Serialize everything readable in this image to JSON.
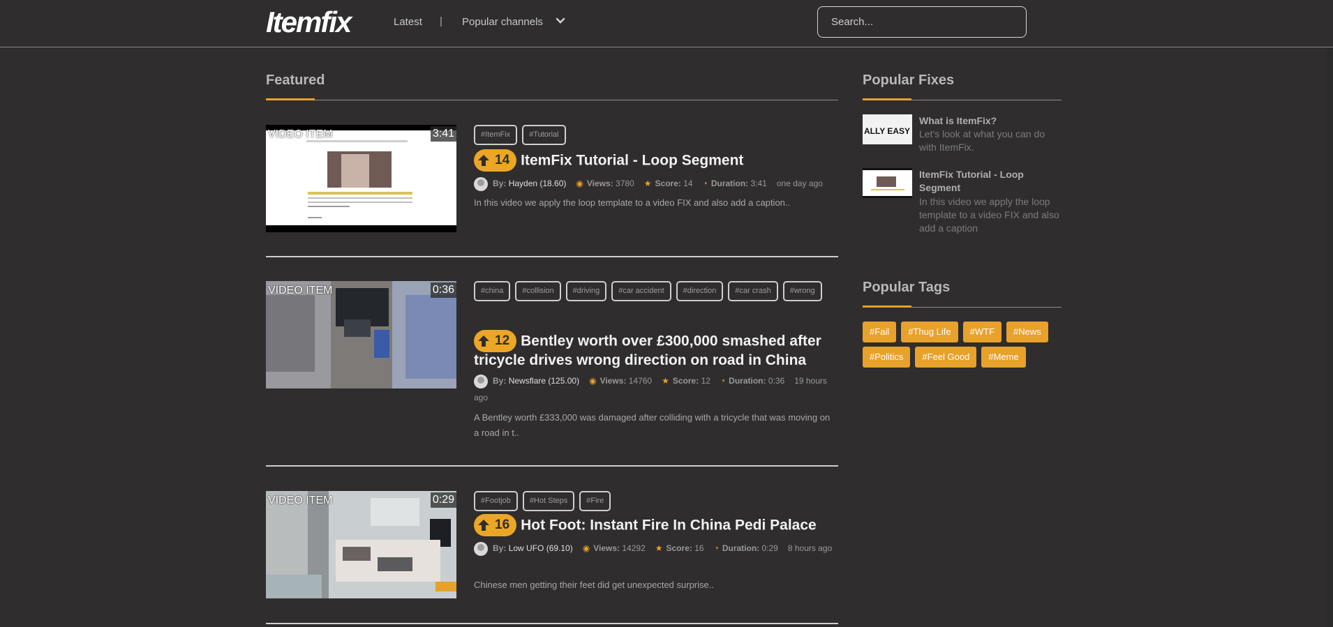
{
  "header": {
    "logo": "Itemfix",
    "nav_latest": "Latest",
    "nav_separator": "|",
    "nav_popular": "Popular channels",
    "search_placeholder": "Search..."
  },
  "featured": {
    "title": "Featured",
    "items": [
      {
        "thumb_label": "VIDEO ITEM",
        "duration": "3:41",
        "tags": [
          "#ItemFix",
          "#Tutorial"
        ],
        "votes": "14",
        "title": "ItemFix Tutorial - Loop Segment",
        "author": "Hayden (18.60)",
        "views": "3780",
        "score": "14",
        "duration_meta": "3:41",
        "ago": "one day ago",
        "description": "In this video we apply the loop template to a video FIX and also add a caption.."
      },
      {
        "thumb_label": "VIDEO ITEM",
        "duration": "0:36",
        "tags": [
          "#china",
          "#collision",
          "#driving",
          "#car accident",
          "#direction",
          "#car crash",
          "#wrong"
        ],
        "votes": "12",
        "title": "Bentley worth over £300,000 smashed after tricycle drives wrong direction on road in China",
        "author": "Newsflare (125.00)",
        "views": "14760",
        "score": "12",
        "duration_meta": "0:36",
        "ago": "19 hours ago",
        "description": "A Bentley worth £333,000 was damaged after colliding with a tricycle that was moving on a road in t.."
      },
      {
        "thumb_label": "VIDEO ITEM",
        "duration": "0:29",
        "tags": [
          "#Footjob",
          "#Hot Steps",
          "#Fire"
        ],
        "votes": "16",
        "title": "Hot Foot: Instant Fire In China Pedi Palace",
        "author": "Low UFO (69.10)",
        "views": "14292",
        "score": "16",
        "duration_meta": "0:29",
        "ago": "8 hours ago",
        "description": "Chinese men getting their feet did get unexpected surprise.."
      }
    ],
    "meta_labels": {
      "by": "By:",
      "views": "Views:",
      "score": "Score:",
      "duration": "Duration:"
    }
  },
  "popular_fixes": {
    "title": "Popular Fixes",
    "items": [
      {
        "thumb_text": "ALLY EASY",
        "title": "What is ItemFix?",
        "description": "Let's look at what you can do with ItemFix."
      },
      {
        "thumb_text": "",
        "title": "ItemFix Tutorial - Loop Segment",
        "description": "In this video we apply the loop template to a video FIX and also add a caption"
      }
    ]
  },
  "popular_tags": {
    "title": "Popular Tags",
    "tags": [
      "#Fail",
      "#Thug Life",
      "#WTF",
      "#News",
      "#Politics",
      "#Feel Good",
      "#Meme"
    ]
  },
  "colors": {
    "accent": "#e8a12b",
    "background": "#2f2d2e"
  }
}
